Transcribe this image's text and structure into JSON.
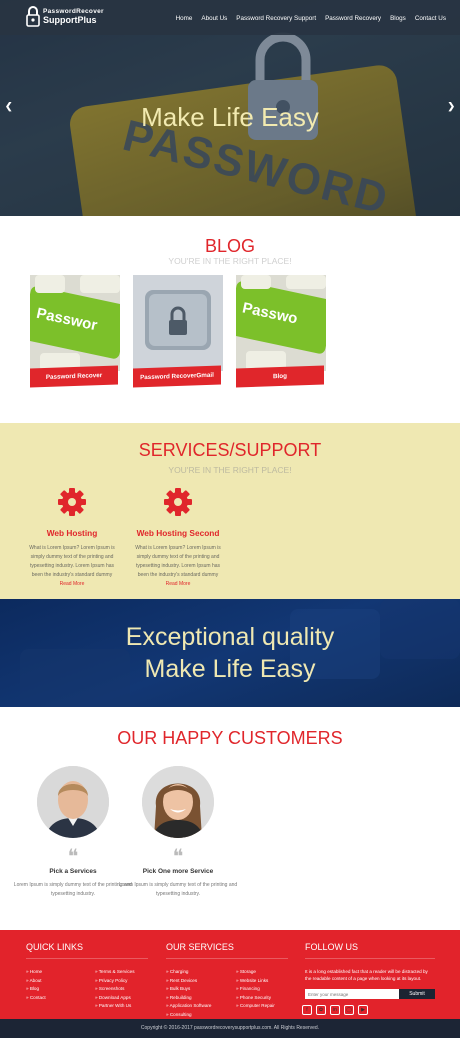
{
  "header": {
    "logo_line1": "PasswordRecover",
    "logo_line2": "SupportPlus",
    "nav": [
      "Home",
      "About Us",
      "Password Recovery Support",
      "Password Recovery",
      "Blogs",
      "Contact Us"
    ]
  },
  "hero": {
    "title": "Make Life Easy",
    "image_text": "PASSWORD",
    "prev_icon": "chevron-left-icon",
    "next_icon": "chevron-right-icon"
  },
  "blog": {
    "title": "BLOG",
    "subtitle": "YOU'RE IN THE RIGHT PLACE!",
    "cards": [
      {
        "label": "Password Recover",
        "image_text": "Passwor"
      },
      {
        "label": "Password RecoverGmail",
        "image_text": ""
      },
      {
        "label": "Blog",
        "image_text": "Passwo"
      }
    ]
  },
  "services": {
    "title": "SERVICES/SUPPORT",
    "subtitle": "YOU'RE IN THE RIGHT PLACE!",
    "items": [
      {
        "title": "Web Hosting",
        "text": "What is Lorem Ipsum? Lorem Ipsum is simply dummy text of the printing and typesetting industry. Lorem Ipsum has been the industry's standard dummy",
        "more": "Read More"
      },
      {
        "title": "Web Hosting Second",
        "text": "What is Lorem Ipsum? Lorem Ipsum is simply dummy text of the printing and typesetting industry. Lorem Ipsum has been the industry's standard dummy",
        "more": "Read More"
      }
    ]
  },
  "quality": {
    "line1": "Exceptional quality",
    "line2": "Make Life Easy"
  },
  "customers": {
    "title": "OUR HAPPY CUSTOMERS",
    "items": [
      {
        "title": "Pick a Services",
        "text": "Lorem Ipsum is simply dummy text of the printing and typesetting industry."
      },
      {
        "title": "Pick One more Service",
        "text": "Lorem Ipsum is simply dummy text of the printing and typesetting industry."
      }
    ]
  },
  "footer": {
    "quick_links_title": "QUICK LINKS",
    "quick_links_col1": [
      "Home",
      "About",
      "Blog",
      "Contact"
    ],
    "quick_links_col2": [
      "Terms & Services",
      "Privacy Policy",
      "Screenshots",
      "Download Apps",
      "Partner With Us"
    ],
    "services_title": "OUR SERVICES",
    "services_col1": [
      "Charging",
      "Rent Devices",
      "Bulk Buys",
      "Rebuilding",
      "Application Software",
      "Consulting"
    ],
    "services_col2": [
      "Storage",
      "Website Links",
      "Financing",
      "Phone Security",
      "Computer Repair"
    ],
    "follow_title": "FOLLOW US",
    "follow_text": "It is a long established fact that a reader will be distracted by the readable content of a page when looking at its layout.",
    "newsletter_placeholder": "Enter your message",
    "newsletter_button": "Submit",
    "social": [
      "facebook-icon",
      "twitter-icon",
      "linkedin-icon",
      "pinterest-icon",
      "youtube-icon"
    ],
    "copyright": "Copyright © 2016-2017 passwordrecoverysupportplus.com. All Rights Reserved."
  },
  "colors": {
    "accent_red": "#e0262b",
    "cream": "#efe8b2",
    "navy": "#0e2a5c",
    "header_dark": "#283442"
  }
}
